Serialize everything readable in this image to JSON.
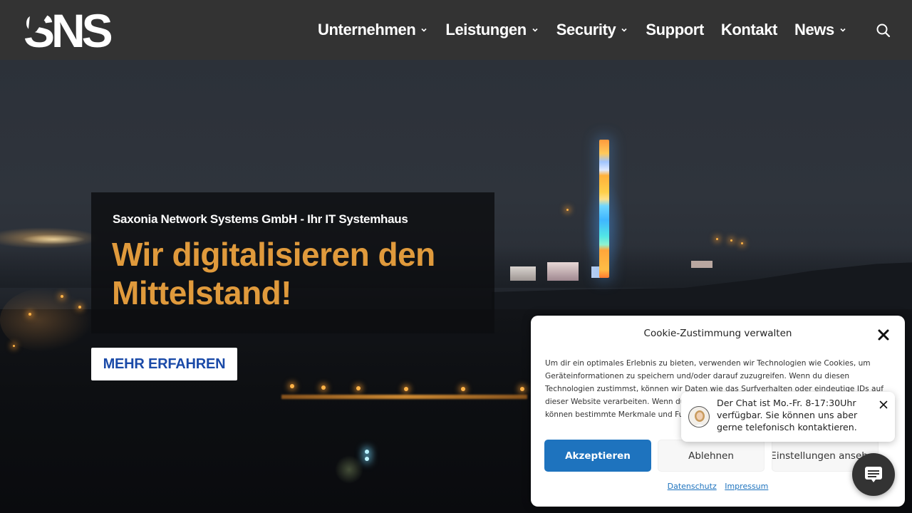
{
  "header": {
    "logo_text": "SNS",
    "nav": [
      {
        "label": "Unternehmen",
        "has_dropdown": true
      },
      {
        "label": "Leistungen",
        "has_dropdown": true
      },
      {
        "label": "Security",
        "has_dropdown": true
      },
      {
        "label": "Support",
        "has_dropdown": false
      },
      {
        "label": "Kontakt",
        "has_dropdown": false
      },
      {
        "label": "News",
        "has_dropdown": true
      }
    ],
    "search_icon": "search-icon"
  },
  "hero": {
    "subtitle": "Saxonia Network Systems GmbH - Ihr IT Systemhaus",
    "title": "Wir digitalisieren den Mittelstand!",
    "cta_label": "MEHR ERFAHREN",
    "title_color": "#e09a3c",
    "cta_color": "#1a4aa8"
  },
  "cookie_dialog": {
    "title": "Cookie-Zustimmung verwalten",
    "text": "Um dir ein optimales Erlebnis zu bieten, verwenden wir Technologien wie Cookies, um Geräteinformationen zu speichern und/oder darauf zuzugreifen. Wenn du diesen Technologien zustimmst, können wir Daten wie das Surfverhalten oder eindeutige IDs auf dieser Website verarbeiten. Wenn du deine Zustimmung nicht erteilst oder zurückziehst, können bestimmte Merkmale und Funktionen beeinträchtigt werden.",
    "buttons": {
      "accept": "Akzeptieren",
      "deny": "Ablehnen",
      "preferences": "Einstellungen ansehen"
    },
    "links": {
      "privacy": "Datenschutz",
      "imprint": "Impressum"
    },
    "accent_color": "#1e73be"
  },
  "chat": {
    "message": "Der Chat ist Mo.-Fr. 8-17:30Uhr verfügbar. Sie können uns aber gerne telefonisch kontaktieren.",
    "launcher_icon": "chat-icon"
  }
}
